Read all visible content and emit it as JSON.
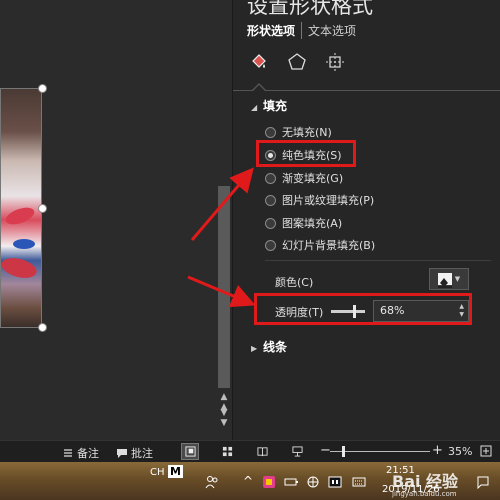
{
  "pane": {
    "title": "设置形状格式",
    "tabs": [
      "形状选项",
      "文本选项"
    ],
    "icons": [
      "fill-line-icon",
      "effects-pentagon-icon",
      "size-properties-icon"
    ],
    "fill_section": {
      "title": "填充",
      "options": [
        "无填充(N)",
        "纯色填充(S)",
        "渐变填充(G)",
        "图片或纹理填充(P)",
        "图案填充(A)",
        "幻灯片背景填充(B)"
      ],
      "selected": "纯色填充(S)",
      "color_label": "颜色(C)",
      "transparency_label": "透明度(T)",
      "transparency_value": "68%",
      "transparency_fraction": 0.68
    },
    "line_section": {
      "title": "线条"
    }
  },
  "statusbar": {
    "notes_label": "备注",
    "comments_label": "批注",
    "zoom_value": "35%",
    "zoom_minus": "−",
    "zoom_plus": "+"
  },
  "taskbar": {
    "ime": "CH",
    "ime_mode": "M",
    "time": "21:51",
    "date": "2019/11/26"
  },
  "watermark": {
    "brand": "Bai 经验",
    "url": "jingyan.baidu.com"
  },
  "colors": {
    "annotation_red": "#e01a1a",
    "pane_bg": "#262626",
    "accent_fill_icon": "#d9534f"
  }
}
